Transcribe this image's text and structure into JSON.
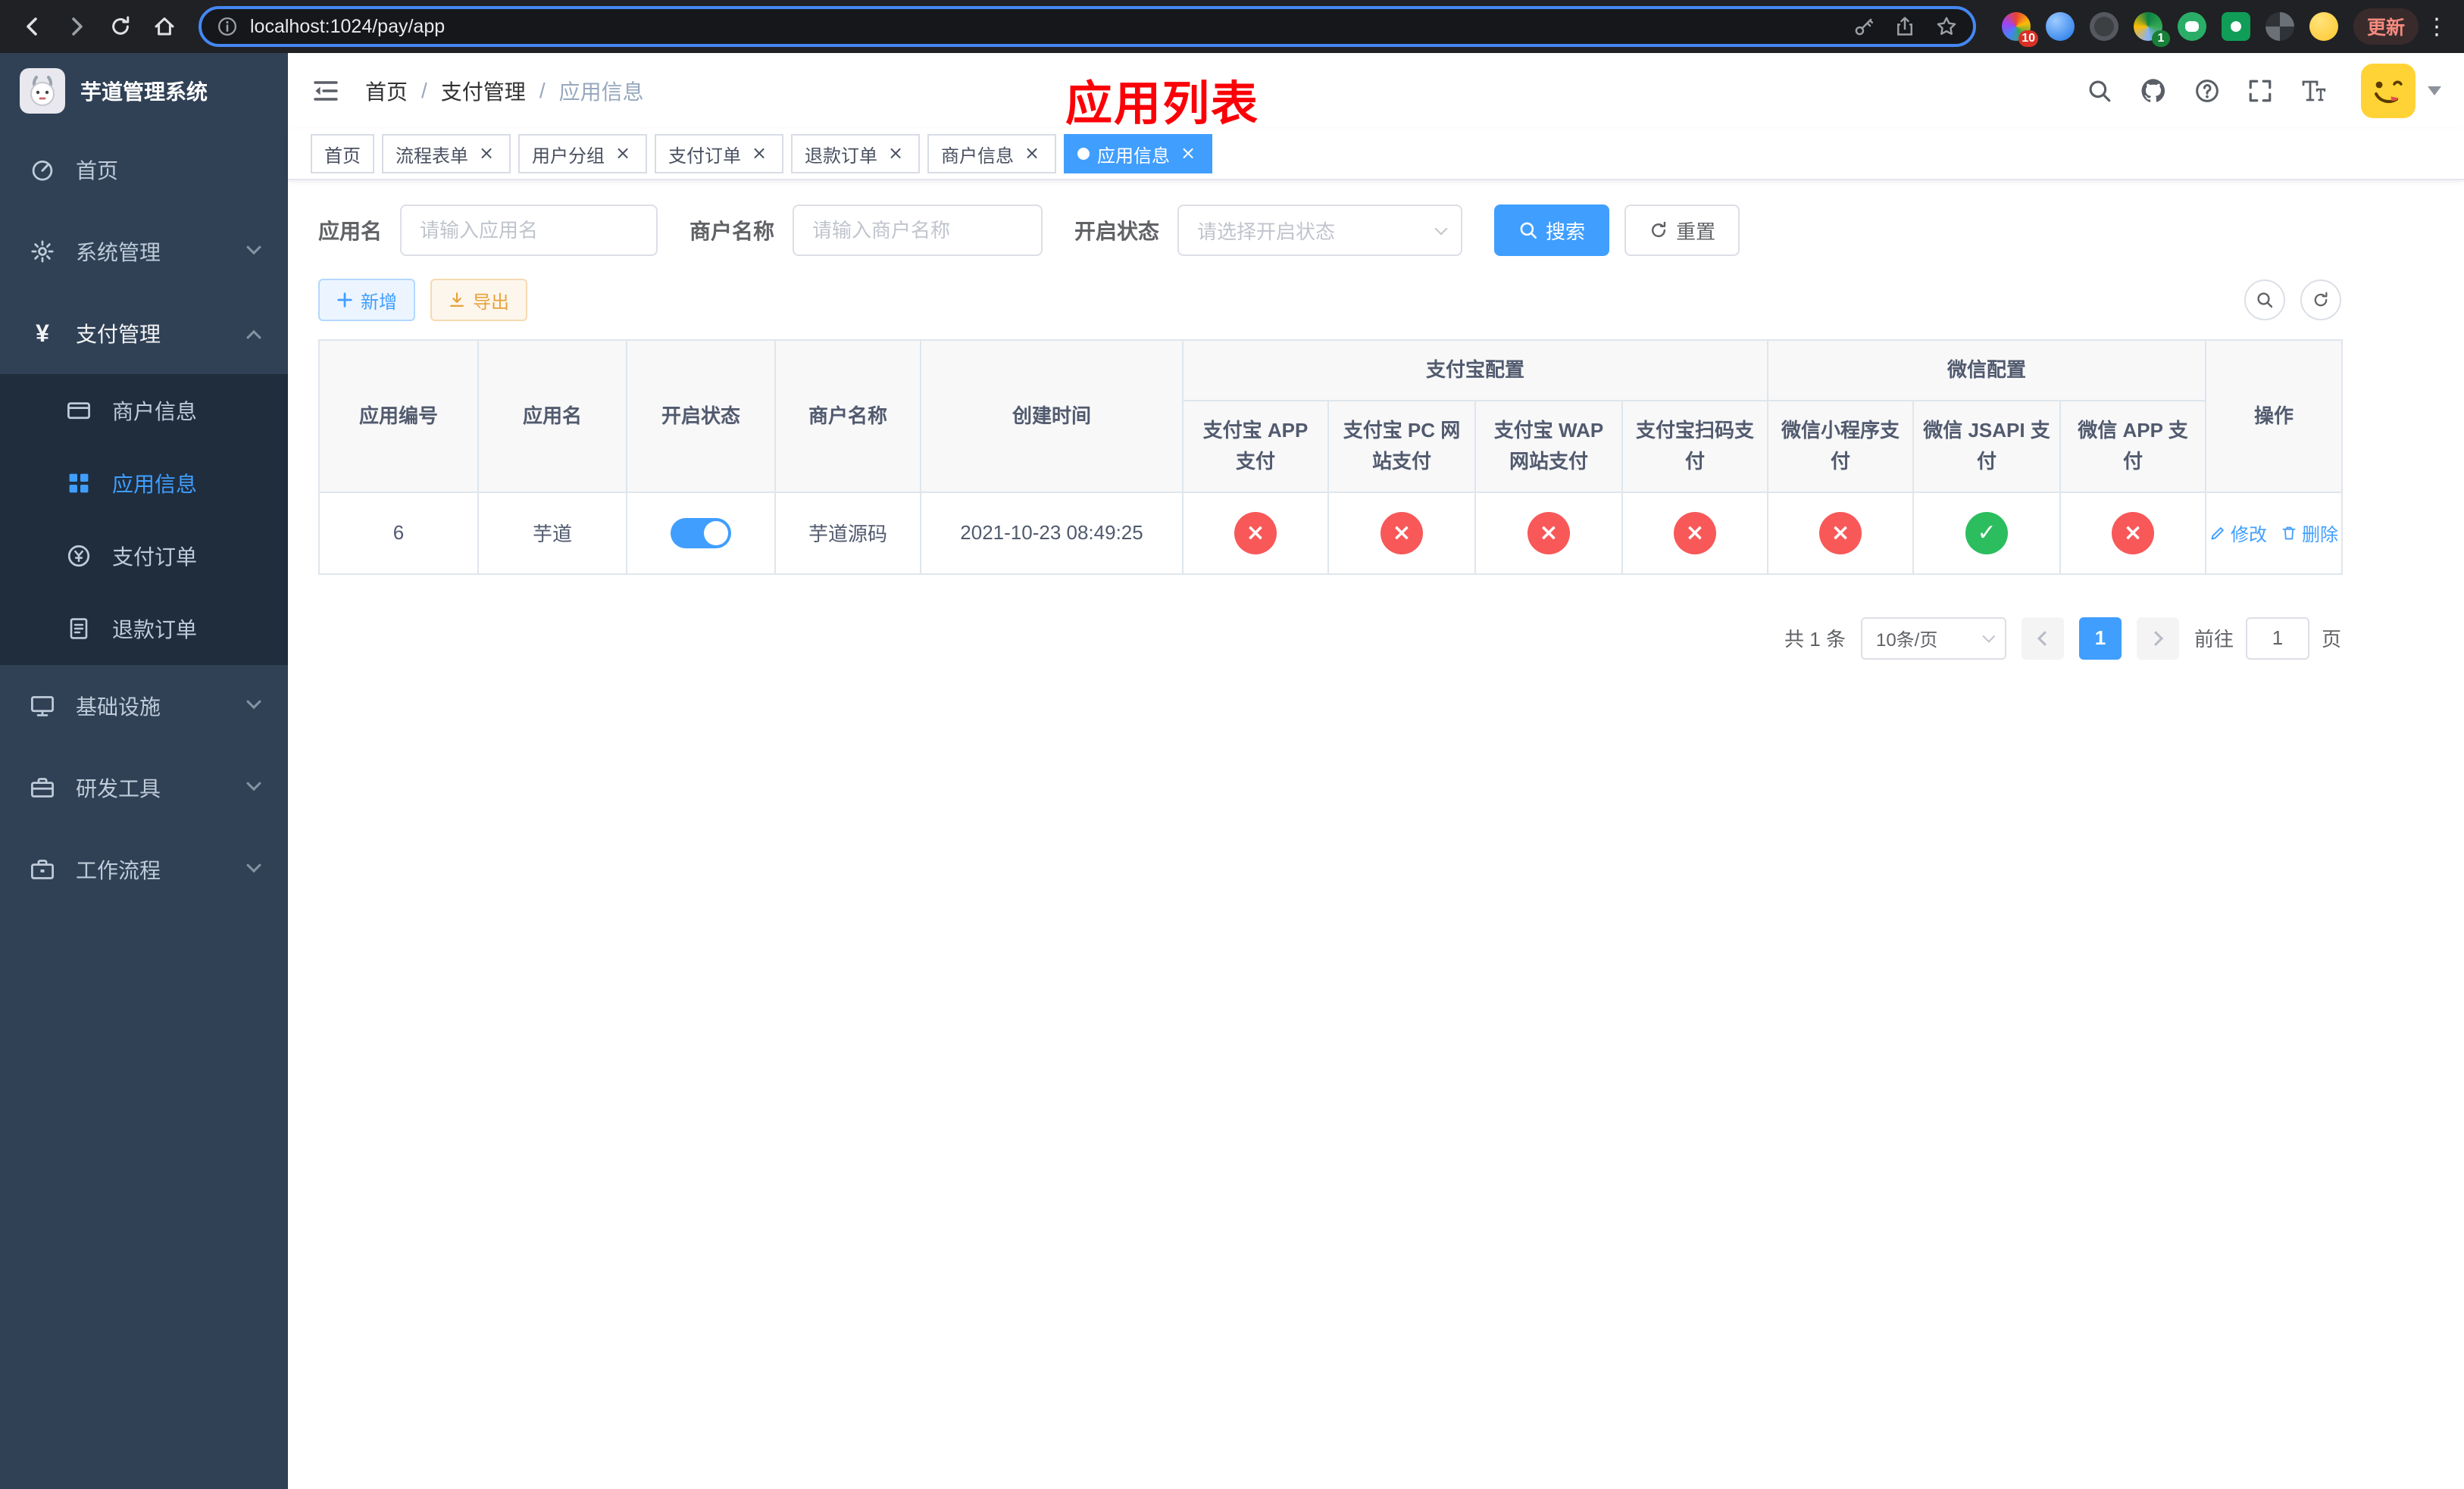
{
  "browser": {
    "url": "localhost:1024/pay/app",
    "update_label": "更新",
    "ext_badge_puzzle": "10",
    "ext_badge_profile": "1"
  },
  "sidebar": {
    "title": "芋道管理系统",
    "items": [
      {
        "label": "首页"
      },
      {
        "label": "系统管理"
      },
      {
        "label": "支付管理"
      },
      {
        "label": "商户信息"
      },
      {
        "label": "应用信息"
      },
      {
        "label": "支付订单"
      },
      {
        "label": "退款订单"
      },
      {
        "label": "基础设施"
      },
      {
        "label": "研发工具"
      },
      {
        "label": "工作流程"
      }
    ]
  },
  "navbar": {
    "breadcrumb": [
      "首页",
      "支付管理",
      "应用信息"
    ],
    "overlay_title": "应用列表"
  },
  "tabs": [
    {
      "label": "首页"
    },
    {
      "label": "流程表单"
    },
    {
      "label": "用户分组"
    },
    {
      "label": "支付订单"
    },
    {
      "label": "退款订单"
    },
    {
      "label": "商户信息"
    },
    {
      "label": "应用信息"
    }
  ],
  "filters": {
    "app_name": {
      "label": "应用名",
      "placeholder": "请输入应用名"
    },
    "merchant_name": {
      "label": "商户名称",
      "placeholder": "请输入商户名称"
    },
    "status": {
      "label": "开启状态",
      "placeholder": "请选择开启状态"
    },
    "search_label": "搜索",
    "reset_label": "重置"
  },
  "toolbar": {
    "add_label": "新增",
    "export_label": "导出"
  },
  "table": {
    "headers": {
      "app_id": "应用编号",
      "app_name": "应用名",
      "status": "开启状态",
      "merchant_name": "商户名称",
      "create_time": "创建时间",
      "alipay_group": "支付宝配置",
      "wechat_group": "微信配置",
      "alipay_app": "支付宝 APP 支付",
      "alipay_pc": "支付宝 PC 网站支付",
      "alipay_wap": "支付宝 WAP 网站支付",
      "alipay_qr": "支付宝扫码支付",
      "wechat_lite": "微信小程序支付",
      "wechat_jsapi": "微信 JSAPI 支付",
      "wechat_app": "微信 APP 支付",
      "actions": "操作"
    },
    "rows": [
      {
        "app_id": "6",
        "app_name": "芋道",
        "status": "on",
        "merchant_name": "芋道源码",
        "create_time": "2021-10-23 08:49:25",
        "alipay_app": "no",
        "alipay_pc": "no",
        "alipay_wap": "no",
        "alipay_qr": "no",
        "wechat_lite": "no",
        "wechat_jsapi": "yes",
        "wechat_app": "no",
        "edit_label": "修改",
        "delete_label": "删除"
      }
    ]
  },
  "pagination": {
    "total": "共 1 条",
    "page_size": "10条/页",
    "page": "1",
    "goto_label": "前往",
    "goto_value": "1",
    "unit_label": "页"
  }
}
